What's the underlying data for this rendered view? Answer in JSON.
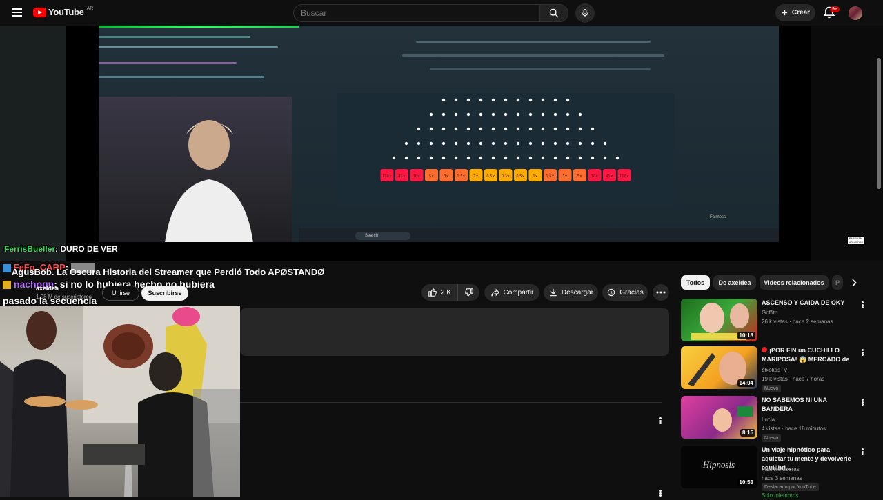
{
  "header": {
    "logo_text": "YouTube",
    "country_code": "AR",
    "search_placeholder": "Buscar",
    "create_label": "Crear",
    "notifications_badge": "9+"
  },
  "player": {
    "taskbar_search": "Search",
    "fairness_label": "Fairness",
    "clock_time": "12:30 PM",
    "clock_date": "10/7/2023",
    "multipliers": [
      "110",
      "41",
      "10",
      "5",
      "3",
      "1.5",
      "1",
      "0.5",
      "0.3",
      "0.5",
      "1",
      "1.5",
      "3",
      "5",
      "10",
      "41",
      "110"
    ]
  },
  "chat": [
    {
      "user": "FerrisBueller",
      "message": ": DURO DE VER"
    },
    {
      "user": "FeFo_CARP",
      "message": ":"
    },
    {
      "user": "nachoqn",
      "message": ": si no lo hubiera hecho no hubiera"
    },
    {
      "user": "",
      "message": "pasado la secuencia"
    }
  ],
  "video": {
    "title": "AgusBob. La Oscura Historia del Streamer que Perdió Todo APØSTANDØ",
    "channel": "axeldea",
    "subscribers": "1,08 M de suscriptores",
    "join_label": "Unirse",
    "subscribe_label": "Suscribirse",
    "likes": "2 K",
    "share_label": "Compartir",
    "download_label": "Descargar",
    "thanks_label": "Gracias"
  },
  "sidebar": {
    "chips": [
      "Todos",
      "De axeldea",
      "Videos relacionados",
      "P"
    ],
    "recommendations": [
      {
        "title": "ASCENSO Y CAIDA DE OKY",
        "channel": "Griffito",
        "meta": "26 k vistas · hace 2 semanas",
        "duration": "10:18",
        "badge": ""
      },
      {
        "title": "¡POR FIN un CUCHILLO MARIPOSA! 😱 MERCADO de ...",
        "channel": "elxokasTV",
        "meta": "19 k vistas · hace 7 horas",
        "duration": "14:04",
        "badge": "Nuevo"
      },
      {
        "title": "NO SABEMOS NI UNA BANDERA",
        "channel": "Lucia",
        "meta": "4 vistas · hace 18 minutos",
        "duration": "8:15",
        "badge": "Nuevo"
      },
      {
        "title": "Un viaje hipnótico para aquietar tu mente y devolverle equilibri...",
        "channel": "Manifestadoras",
        "meta": "hace 3 semanas",
        "duration": "10:53",
        "badge": "Destacado por YouTube",
        "extra": "Solo miembros"
      }
    ]
  },
  "colors": {
    "background": "#0f0f0f",
    "brand_red": "#ff0000",
    "chip_active": "#f1f1f1"
  }
}
